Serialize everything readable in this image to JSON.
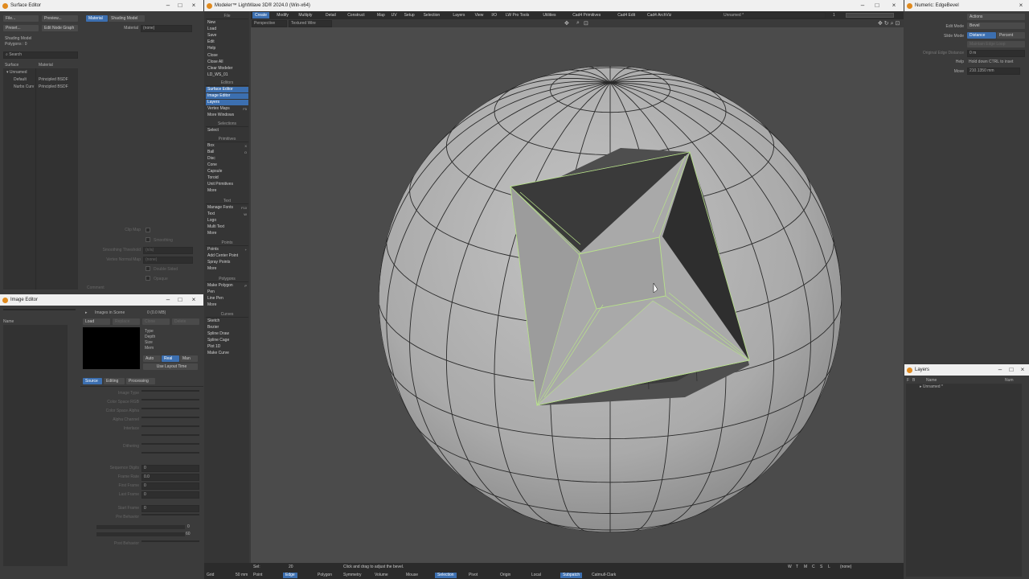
{
  "surface_editor": {
    "title": "Surface Editor",
    "file_btn": "File...",
    "preview_btn": "Preview...",
    "tab_material": "Material",
    "tab_shading": "Shading Model",
    "preset_btn": "Preset...",
    "edit_node_graph": "Edit Node Graph",
    "material_label": "Material",
    "material_value": "(none)",
    "shading_model_label": "Shading Model",
    "polygons_label": "Polygons : 0",
    "search_placeholder": "Search",
    "col_surface": "Surface",
    "col_material": "Material",
    "rows": [
      {
        "surface": "Unnamed",
        "material": ""
      },
      {
        "surface": "Default",
        "material": "Principled BSDF"
      },
      {
        "surface": "Nurbs Curv",
        "material": "Principled BSDF"
      }
    ],
    "clip_map": "Clip Map",
    "smoothing": "Smoothing",
    "smoothing_threshold": "Smoothing Threshold",
    "smoothing_threshold_val": "(n/a)",
    "vertex_normal_map": "Vertex Normal Map",
    "vertex_normal_map_val": "(none)",
    "double_sided": "Double Sided",
    "opaque": "Opaque",
    "comment": "Comment"
  },
  "image_editor": {
    "title": "Image Editor",
    "images_in_scene": "Images in Scene",
    "mem": "0 (0.0 MB)",
    "col_name": "Name",
    "load_btn": "Load",
    "replace_btn": "Replace",
    "clone_btn": "Clone",
    "delete_btn": "Delete",
    "type_label": "Type",
    "depth_label": "Depth",
    "size_label": "Size",
    "mem_label": "Mem",
    "auto_btn": "Auto",
    "real_btn": "Real",
    "man_btn": "Man",
    "use_layout_time": "Use Layout Time",
    "tab_source": "Source",
    "tab_editing": "Editing",
    "tab_processing": "Processing",
    "image_type": "Image Type",
    "color_space_rgb": "Color Space RGB",
    "color_space_alpha": "Color Space Alpha",
    "alpha_channel": "Alpha Channel",
    "interlace": "Interlace",
    "dithering": "Dithering",
    "sequence_digits": "Sequence Digits",
    "sequence_digits_val": "0",
    "frame_rate": "Frame Rate",
    "frame_rate_val": "0.0",
    "first_frame": "First Frame",
    "first_frame_val": "0",
    "last_frame": "Last Frame",
    "last_frame_val": "0",
    "start_frame": "Start Frame",
    "start_frame_val": "0",
    "pre_behavior": "Pre Behavior",
    "post_behavior": "Post Behavior",
    "slider_a_val": "0",
    "slider_b_val": "60"
  },
  "modeler": {
    "title": "Modeler™ LightWave 3D® 2024.0 (Win-x64)",
    "menu": [
      "Create",
      "Modify",
      "Multiply",
      "Detail",
      "Construct",
      "Map",
      "UV",
      "Setup",
      "Selection",
      "Layers",
      "View",
      "I/O",
      "LW Pro Tools",
      "Utilities",
      "Cad4 Primitives",
      "Cad4 Edit",
      "Cad4 ArchViz"
    ],
    "active_menu": "Create",
    "object_name": "Unnamed *",
    "viewport_mode": "Perspective",
    "shading_mode": "Textured Wire",
    "layer_nums": "1"
  },
  "toolbar": {
    "file_items": [
      "New",
      "Load",
      "Save",
      "Edit",
      "Help"
    ],
    "file_header": "File",
    "misc_items": [
      "Close",
      "Close All",
      "Clear Modeler",
      "LD_WS_01"
    ],
    "editors_header": "Editors",
    "editor_items": [
      "Surface Editor",
      "Image Editor",
      "Layers",
      "Vertex Maps",
      "More Windows"
    ],
    "vertex_maps_key": "F5",
    "selections_header": "Selections",
    "select_item": "Select",
    "primitives_header": "Primitives",
    "primitive_items": [
      "Box",
      "Ball",
      "Disc",
      "Cone",
      "Capsule",
      "Toroid",
      "Unit Primitives",
      "More"
    ],
    "box_key": "X",
    "ball_key": "O",
    "text_header": "Text",
    "text_items": [
      "Manage Fonts",
      "Text",
      "Logo",
      "Multi Text",
      "More"
    ],
    "manage_fonts_key": "F10",
    "text_key": "W",
    "points_header": "Points",
    "point_items": [
      "Points",
      "Add Center Point",
      "Spray Points",
      "More"
    ],
    "points_key": "+",
    "polygons_header": "Polygons",
    "polygon_items": [
      "Make Polygon",
      "Pen",
      "Line Pen",
      "More"
    ],
    "make_polygon_key": "P",
    "curves_header": "Curves",
    "curve_items": [
      "Sketch",
      "Bezier",
      "Spline Draw",
      "Spline Cage",
      "Plot 1D",
      "Make Curve"
    ]
  },
  "numeric": {
    "title": "Numeric: EdgeBevel",
    "actions": "Actions",
    "edit_mode_label": "Edit Mode",
    "edit_mode_val": "Bevel",
    "slide_mode_label": "Slide Mode",
    "slide_distance": "Distance",
    "slide_percent": "Percent",
    "maintain_label": "Maintain Edge Loop",
    "distance_label": "Original Edge Distance",
    "distance_val": "0 m",
    "help_label": "Help",
    "help_text": "Hold down CTRL to inset",
    "move_label": "Move",
    "move_val": "210.1350 mm"
  },
  "layers": {
    "title": "Layers",
    "col_f": "F",
    "col_b": "B",
    "col_name": "Name",
    "col_num": "Num",
    "item": "Unnamed *"
  },
  "status": {
    "sel_label": "Sel:",
    "sel_val": "20",
    "hint": "Click and drag to adjust the bevel.",
    "grid_label": "Grid",
    "grid_val": "50 mm",
    "modes": [
      "Point",
      "Edge",
      "Polygon"
    ],
    "active_mode": "Edge",
    "bottom_items": [
      "Symmetry",
      "Volume",
      "Mouse",
      "Selection",
      "Pivot",
      "Origin",
      "Local",
      "Subpatch",
      "Catmull-Clark"
    ],
    "right_buttons": [
      "W",
      "T",
      "M",
      "C",
      "S",
      "L"
    ],
    "none_val": "(none)"
  },
  "colors": {
    "accent": "#3c6fb0",
    "selection": "#b8e28a",
    "viewport": "#4b4b4b"
  }
}
